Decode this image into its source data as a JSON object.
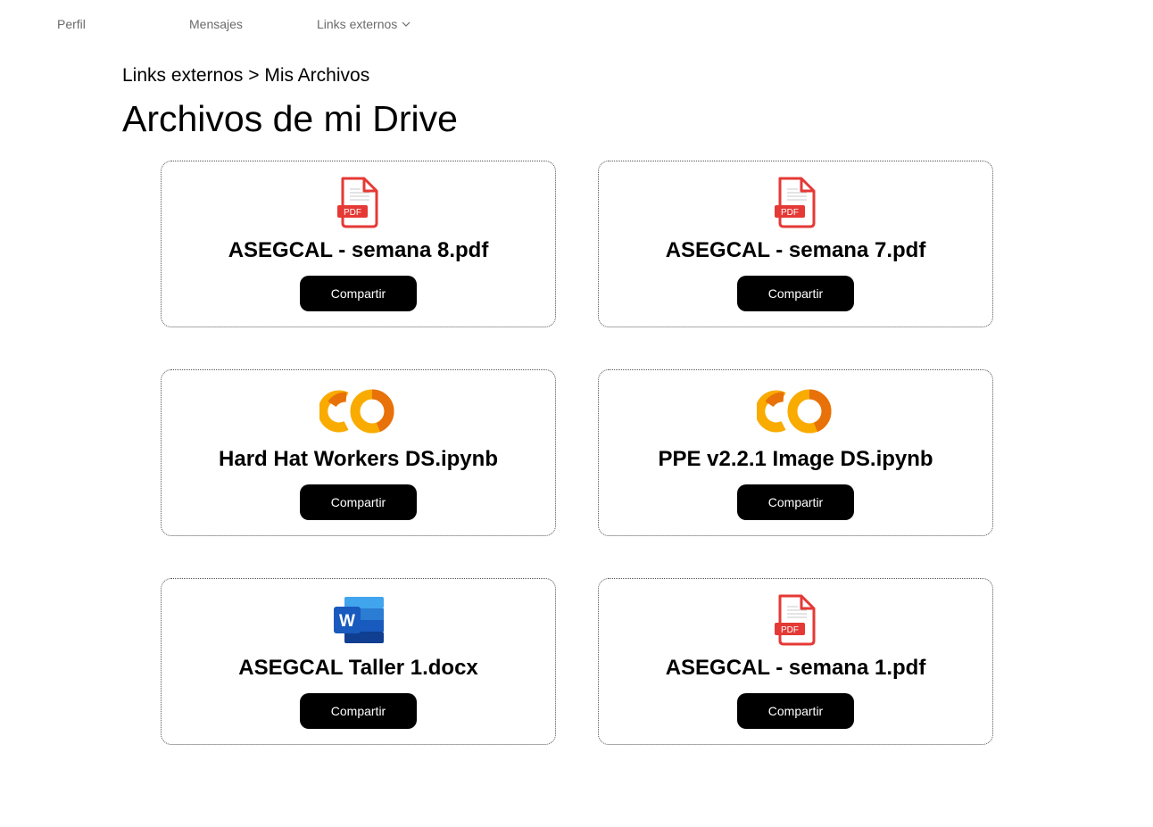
{
  "nav": {
    "items": [
      {
        "label": "Perfil"
      },
      {
        "label": "Mensajes"
      },
      {
        "label": "Links externos"
      }
    ]
  },
  "breadcrumb": "Links externos > Mis Archivos",
  "page_title": "Archivos de mi Drive",
  "files": [
    {
      "name": "ASEGCAL - semana 8.pdf",
      "icon": "pdf-icon",
      "button": "Compartir"
    },
    {
      "name": "ASEGCAL - semana 7.pdf",
      "icon": "pdf-icon",
      "button": "Compartir"
    },
    {
      "name": "Hard Hat Workers DS.ipynb",
      "icon": "colab-icon",
      "button": "Compartir"
    },
    {
      "name": "PPE v2.2.1 Image DS.ipynb",
      "icon": "colab-icon",
      "button": "Compartir"
    },
    {
      "name": "ASEGCAL Taller 1.docx",
      "icon": "word-icon",
      "button": "Compartir"
    },
    {
      "name": "ASEGCAL - semana 1.pdf",
      "icon": "pdf-icon",
      "button": "Compartir"
    }
  ],
  "colors": {
    "pdf_red": "#e53935",
    "colab_orange": "#f9ab00",
    "colab_dark_orange": "#e8710a",
    "word_blue": "#185abd",
    "button_bg": "#000000"
  }
}
